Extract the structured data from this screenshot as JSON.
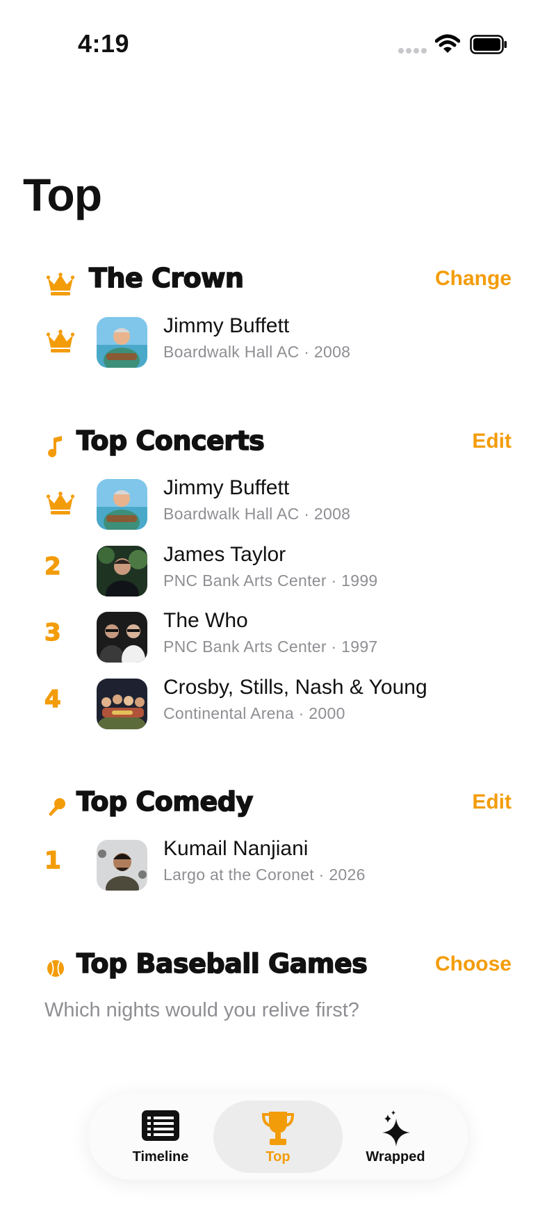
{
  "status_bar": {
    "time": "4:19"
  },
  "page_title": "Top",
  "colors": {
    "accent": "#f39c0a",
    "secondary_text": "#8e8e93"
  },
  "crown": {
    "title": "The Crown",
    "action": "Change",
    "item": {
      "rank_icon": "crown-icon",
      "artist": "Jimmy Buffett",
      "venue_year": "Boardwalk Hall AC · 2008"
    }
  },
  "concerts": {
    "title": "Top Concerts",
    "icon": "music-note-icon",
    "action": "Edit",
    "items": [
      {
        "rank": "crown",
        "artist": "Jimmy Buffett",
        "venue_year": "Boardwalk Hall AC · 2008"
      },
      {
        "rank": "2",
        "artist": "James Taylor",
        "venue_year": "PNC Bank Arts Center · 1999"
      },
      {
        "rank": "3",
        "artist": "The Who",
        "venue_year": "PNC Bank Arts Center · 1997"
      },
      {
        "rank": "4",
        "artist": "Crosby, Stills, Nash & Young",
        "venue_year": "Continental Arena · 2000"
      }
    ]
  },
  "comedy": {
    "title": "Top Comedy",
    "icon": "microphone-icon",
    "action": "Edit",
    "items": [
      {
        "rank": "1",
        "artist": "Kumail Nanjiani",
        "venue_year": "Largo at the Coronet · 2026"
      }
    ]
  },
  "baseball": {
    "title": "Top Baseball Games",
    "icon": "baseball-icon",
    "action": "Choose",
    "prompt": "Which nights would you relive first?"
  },
  "tabs": [
    {
      "label": "Timeline",
      "icon": "timeline-list-icon",
      "active": false
    },
    {
      "label": "Top",
      "icon": "trophy-icon",
      "active": true
    },
    {
      "label": "Wrapped",
      "icon": "sparkles-icon",
      "active": false
    }
  ]
}
